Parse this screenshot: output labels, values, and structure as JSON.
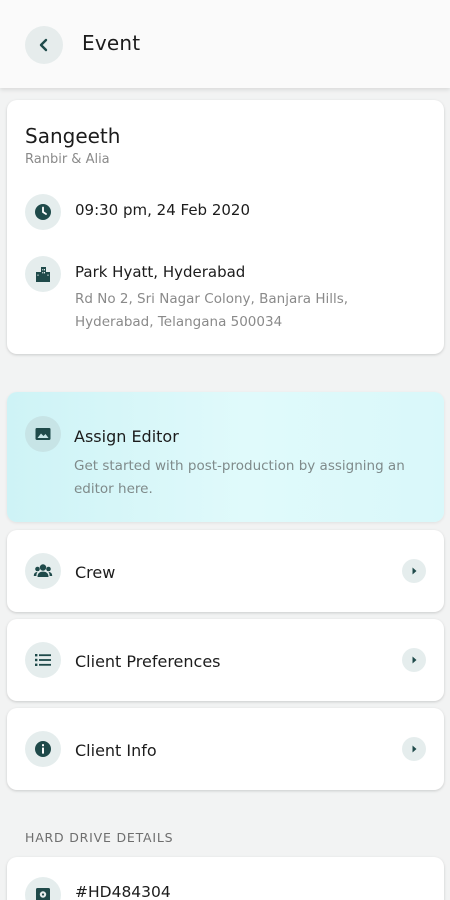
{
  "header": {
    "title": "Event",
    "back_icon": "chevron-left-icon"
  },
  "event": {
    "name": "Sangeeth",
    "subtitle": "Ranbir & Alia",
    "datetime": "09:30 pm, 24 Feb 2020",
    "venue_name": "Park Hyatt, Hyderabad",
    "venue_address": "Rd No 2, Sri Nagar Colony, Banjara Hills, Hyderabad, Telangana 500034"
  },
  "assign_editor": {
    "title": "Assign Editor",
    "description": "Get started with post-production by assigning an editor here."
  },
  "menu": [
    {
      "label": "Crew",
      "icon": "group-icon"
    },
    {
      "label": "Client Preferences",
      "icon": "list-icon"
    },
    {
      "label": "Client Info",
      "icon": "info-icon"
    }
  ],
  "hard_drive": {
    "section_title": "HARD DRIVE DETAILS",
    "id": "#HD484304"
  },
  "colors": {
    "accent_dark": "#1f4a4a",
    "icon_bg": "#e5eded",
    "highlight_bg": "#d9f8fa",
    "page_bg": "#f2f3f3"
  }
}
